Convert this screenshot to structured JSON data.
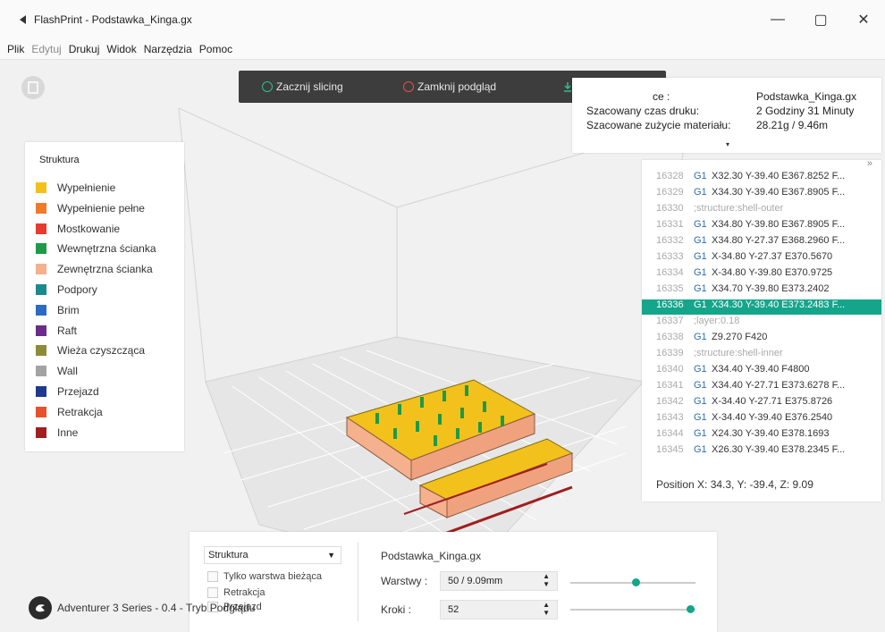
{
  "window": {
    "title": "FlashPrint - Podstawka_Kinga.gx",
    "minimize": "—",
    "maximize": "▢",
    "close": "✕"
  },
  "menu": [
    {
      "label": "Plik",
      "disabled": false
    },
    {
      "label": "Edytuj",
      "disabled": true
    },
    {
      "label": "Drukuj",
      "disabled": false
    },
    {
      "label": "Widok",
      "disabled": false
    },
    {
      "label": "Narzędzia",
      "disabled": false
    },
    {
      "label": "Pomoc",
      "disabled": false
    }
  ],
  "toolbar": {
    "start_slicing": "Zacznij slicing",
    "close_preview": "Zamknij podgląd",
    "start_color": "#2fbf8f",
    "close_color": "#e5514c"
  },
  "info": {
    "name_label": "ce :",
    "name_value": "Podstawka_Kinga.gx",
    "time_label": "Szacowany czas druku:",
    "time_value": "2 Godziny 31 Minuty",
    "material_label": "Szacowane zużycie materiału:",
    "material_value": "28.21g / 9.46m"
  },
  "legend": {
    "title": "Struktura",
    "items": [
      {
        "label": "Wypełnienie",
        "color": "#f3c11b"
      },
      {
        "label": "Wypełnienie pełne",
        "color": "#f07a2a"
      },
      {
        "label": "Mostkowanie",
        "color": "#e83b2f"
      },
      {
        "label": "Wewnętrzna ścianka",
        "color": "#1e9a48"
      },
      {
        "label": "Zewnętrzna ścianka",
        "color": "#f5b08e"
      },
      {
        "label": "Podpory",
        "color": "#1a8a8c"
      },
      {
        "label": "Brim",
        "color": "#2c6bc5"
      },
      {
        "label": "Raft",
        "color": "#6a2d8a"
      },
      {
        "label": "Wieża czyszcząca",
        "color": "#8f8a3a"
      },
      {
        "label": "Wall",
        "color": "#a3a3a3"
      },
      {
        "label": "Przejazd",
        "color": "#1f3a8c"
      },
      {
        "label": "Retrakcja",
        "color": "#e8512c"
      },
      {
        "label": "Inne",
        "color": "#a01e1e"
      }
    ]
  },
  "gcode": {
    "close_glyph": "»",
    "lines": [
      {
        "num": "16328",
        "cmd": "G1",
        "args": "X32.30 Y-39.40 E367.8252 F..."
      },
      {
        "num": "16329",
        "cmd": "G1",
        "args": "X34.30 Y-39.40 E367.8905 F..."
      },
      {
        "num": "16330",
        "comment": ";structure:shell-outer"
      },
      {
        "num": "16331",
        "cmd": "G1",
        "args": "X34.80 Y-39.80 E367.8905 F..."
      },
      {
        "num": "16332",
        "cmd": "G1",
        "args": "X34.80 Y-27.37 E368.2960 F..."
      },
      {
        "num": "16333",
        "cmd": "G1",
        "args": "X-34.80 Y-27.37 E370.5670"
      },
      {
        "num": "16334",
        "cmd": "G1",
        "args": "X-34.80 Y-39.80 E370.9725"
      },
      {
        "num": "16335",
        "cmd": "G1",
        "args": "X34.70 Y-39.80 E373.2402"
      },
      {
        "num": "16336",
        "cmd": "G1",
        "args": "X34.30 Y-39.40 E373.2483 F...",
        "selected": true
      },
      {
        "num": "16337",
        "comment": ";layer:0.18"
      },
      {
        "num": "16338",
        "cmd": "G1",
        "args": "Z9.270 F420"
      },
      {
        "num": "16339",
        "comment": ";structure:shell-inner"
      },
      {
        "num": "16340",
        "cmd": "G1",
        "args": "X34.40 Y-39.40 F4800"
      },
      {
        "num": "16341",
        "cmd": "G1",
        "args": "X34.40 Y-27.71 E373.6278 F..."
      },
      {
        "num": "16342",
        "cmd": "G1",
        "args": "X-34.40 Y-27.71 E375.8726"
      },
      {
        "num": "16343",
        "cmd": "G1",
        "args": "X-34.40 Y-39.40 E376.2540"
      },
      {
        "num": "16344",
        "cmd": "G1",
        "args": "X24.30 Y-39.40 E378.1693"
      },
      {
        "num": "16345",
        "cmd": "G1",
        "args": "X26.30 Y-39.40 E378.2345 F..."
      }
    ],
    "position": "Position  X: 34.3, Y: -39.4, Z: 9.09"
  },
  "bottom": {
    "select_value": "Struktura",
    "only_current_layer": "Tylko warstwa bieżąca",
    "retraction": "Retrakcja",
    "travel": "Przejazd",
    "file_name": "Podstawka_Kinga.gx",
    "layers_label": "Warstwy :",
    "layers_value": "50 / 9.09mm",
    "steps_label": "Kroki :",
    "steps_value": "52",
    "layers_slider_fraction": 0.52,
    "steps_slider_fraction": 0.96
  },
  "status": {
    "text": "Adventurer 3 Series - 0.4 - Tryb Podglądu"
  },
  "accent": "#15a58a"
}
